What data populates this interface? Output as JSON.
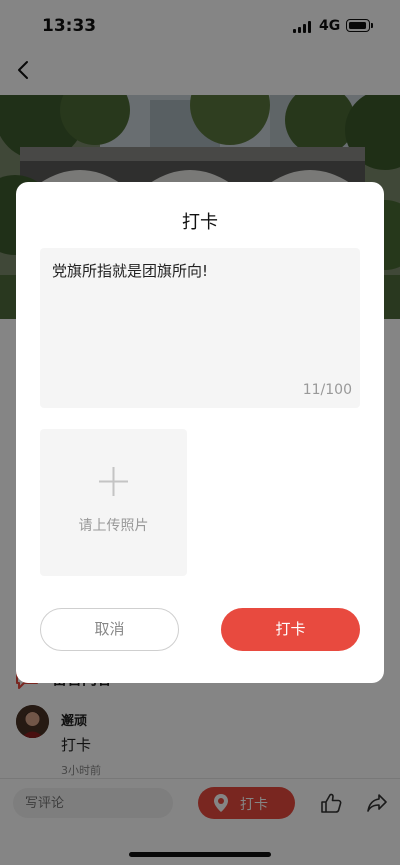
{
  "status_bar": {
    "time": "13:33",
    "network": "4G"
  },
  "comments": {
    "section_title": "留言内容",
    "items": [
      {
        "user": "邂顽",
        "text": "打卡",
        "time": "3小时前"
      }
    ]
  },
  "bottom_bar": {
    "comment_placeholder": "写评论",
    "checkin_label": "打卡"
  },
  "dialog": {
    "title": "打卡",
    "text_value": "党旗所指就是团旗所向!",
    "char_count": "11/100",
    "upload_label": "请上传照片",
    "cancel_label": "取消",
    "confirm_label": "打卡"
  },
  "colors": {
    "accent": "#e84a3f",
    "overlay": "rgba(0,0,0,0.48)"
  }
}
